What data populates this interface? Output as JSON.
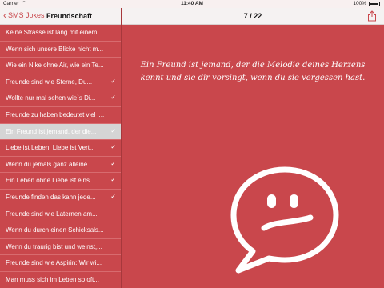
{
  "status": {
    "carrier": "Carrier",
    "time": "11:40 AM",
    "battery": "100%"
  },
  "nav": {
    "back_label": "SMS Jokes",
    "title": "Freundschaft",
    "counter": "7 / 22"
  },
  "list": [
    {
      "label": "Keine Strasse ist lang mit einem...",
      "checked": false
    },
    {
      "label": "Wenn sich unsere Blicke nicht m...",
      "checked": false
    },
    {
      "label": "Wie ein Nike ohne Air, wie ein Te...",
      "checked": false
    },
    {
      "label": "Freunde sind wie Sterne, Du...",
      "checked": true
    },
    {
      "label": "Wollte nur mal sehen wie`s Di...",
      "checked": true
    },
    {
      "label": "Freunde zu haben bedeutet viel i...",
      "checked": false
    },
    {
      "label": "Ein Freund ist jemand, der die...",
      "checked": true,
      "selected": true
    },
    {
      "label": "Liebe ist Leben, Liebe ist Vert...",
      "checked": true
    },
    {
      "label": "Wenn du jemals ganz alleine...",
      "checked": true
    },
    {
      "label": "Ein Leben ohne Liebe ist eins...",
      "checked": true
    },
    {
      "label": "Freunde finden das kann jede...",
      "checked": true
    },
    {
      "label": "Freunde sind wie Laternen am...",
      "checked": false
    },
    {
      "label": "Wenn du durch einen Schicksals...",
      "checked": false
    },
    {
      "label": "Wenn du traurig bist und weinst,...",
      "checked": false
    },
    {
      "label": "Freunde sind wie Aspirin: Wir wi...",
      "checked": false
    },
    {
      "label": "Man muss sich im Leben so oft...",
      "checked": false
    }
  ],
  "detail": {
    "quote": "Ein Freund ist jemand, der die Melodie deines Herzens kennt und sie dir vorsingt, wenn du sie vergessen hast."
  },
  "colors": {
    "accent": "#c9474c",
    "navbar": "#f5f2f2",
    "selected": "#d5d5d5"
  },
  "icons": {
    "back": "chevron-left-icon",
    "share": "share-icon",
    "bubble": "smiley-speech-bubble-icon",
    "check": "checkmark-icon"
  }
}
